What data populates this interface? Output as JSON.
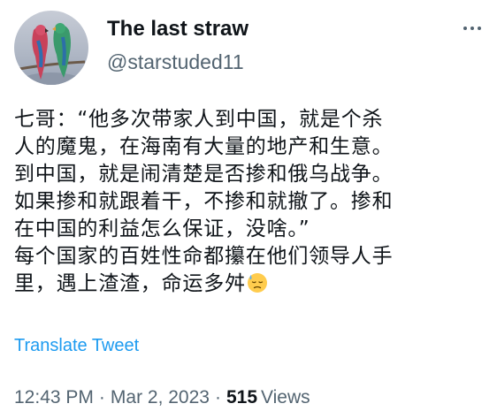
{
  "author": {
    "display_name": "The last straw",
    "handle": "@starstuded11"
  },
  "more_icon": "more-horizontal-icon",
  "tweet": {
    "lines": [
      "七哥：“他多次带家人到中国，就是个杀",
      "人的魔鬼，在海南有大量的地产和生意。",
      "到中国，就是闹清楚是否掺和俄乌战争。",
      "如果掺和就跟着干，不掺和就撤了。掺和",
      "在中国的利益怎么保证，没啥。”",
      "每个国家的百姓性命都攥在他们领导人手",
      "里，遇上渣渣，命运多舛"
    ],
    "emoji": "downcast-face-with-sweat-emoji"
  },
  "translate_label": "Translate Tweet",
  "meta": {
    "time": "12:43 PM",
    "separator": "·",
    "date": "Mar 2, 2023",
    "views_count": "515",
    "views_label": "Views"
  },
  "colors": {
    "text": "#0f1419",
    "secondary": "#536471",
    "link": "#1d9bf0"
  }
}
